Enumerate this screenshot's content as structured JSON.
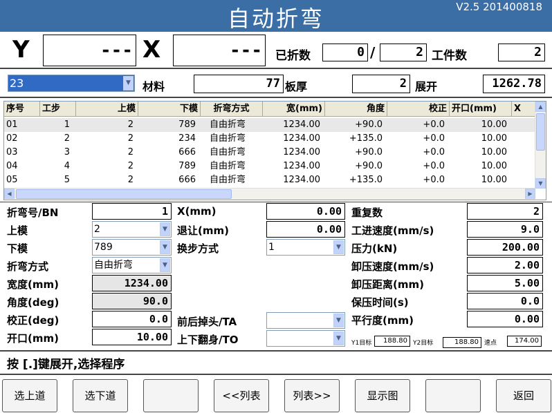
{
  "title": "自动折弯",
  "version": "V2.5 201400818",
  "axis": {
    "y_label": "Y",
    "y_value": "---",
    "x_label": "X",
    "x_value": "---"
  },
  "count": {
    "bent_label": "已折数",
    "bent": "0",
    "separator": "/",
    "total": "2",
    "workpiece_label": "工件数",
    "workpiece": "2"
  },
  "program": {
    "number": "23",
    "material_label": "材料",
    "material": "77",
    "thickness_label": "板厚",
    "thickness": "2",
    "unfold_label": "展开",
    "unfold": "1262.78"
  },
  "table": {
    "headers": [
      "序号",
      "工步",
      "上模",
      "下模",
      "折弯方式",
      "宽(mm)",
      "角度",
      "校正",
      "开口(mm)",
      "X"
    ],
    "rows": [
      [
        "01",
        "1",
        "2",
        "789",
        "自由折弯",
        "1234.00",
        "+90.0",
        "+0.0",
        "10.00"
      ],
      [
        "02",
        "2",
        "2",
        "234",
        "自由折弯",
        "1234.00",
        "+135.0",
        "+0.0",
        "10.00"
      ],
      [
        "03",
        "3",
        "2",
        "666",
        "自由折弯",
        "1234.00",
        "+90.0",
        "+0.0",
        "10.00"
      ],
      [
        "04",
        "4",
        "2",
        "789",
        "自由折弯",
        "1234.00",
        "+90.0",
        "+0.0",
        "10.00"
      ],
      [
        "05",
        "5",
        "2",
        "666",
        "自由折弯",
        "1234.00",
        "+135.0",
        "+0.0",
        "10.00"
      ]
    ]
  },
  "params": {
    "bend_no_label": "折弯号/BN",
    "bend_no": "1",
    "upper_die_label": "上模",
    "upper_die": "2",
    "lower_die_label": "下模",
    "lower_die": "789",
    "bend_mode_label": "折弯方式",
    "bend_mode": "自由折弯",
    "width_label": "宽度(mm)",
    "width": "1234.00",
    "angle_label": "角度(deg)",
    "angle": "90.0",
    "correction_label": "校正(deg)",
    "correction": "0.0",
    "opening_label": "开口(mm)",
    "opening": "10.00",
    "x_label": "X(mm)",
    "x": "0.00",
    "retract_label": "退让(mm)",
    "retract": "0.00",
    "step_mode_label": "换步方式",
    "step_mode": "1",
    "ta_label": "前后掉头/TA",
    "ta": "",
    "to_label": "上下翻身/TO",
    "to": "",
    "repeat_label": "重复数",
    "repeat": "2",
    "work_speed_label": "工进速度(mm/s)",
    "work_speed": "9.0",
    "pressure_label": "压力(kN)",
    "pressure": "200.00",
    "unload_speed_label": "卸压速度(mm/s)",
    "unload_speed": "2.00",
    "unload_dist_label": "卸压距离(mm)",
    "unload_dist": "5.00",
    "hold_time_label": "保压时间(s)",
    "hold_time": "0.0",
    "parallel_label": "平行度(mm)",
    "parallel": "0.00",
    "y1_label": "Y1目标",
    "y1": "188.80",
    "y2_label": "Y2目标",
    "y2": "188.80",
    "speed_label": "速点",
    "speed": "174.00"
  },
  "status": "按 [.]键展开,选择程序",
  "buttons": {
    "prev": "选上道",
    "next": "选下道",
    "blank1": "",
    "list_left": "<<列表",
    "list_right": "列表>>",
    "show_graph": "显示图",
    "blank2": "",
    "back": "返回"
  },
  "colors": {
    "titlebar": "#3a6ea5",
    "selection": "#316ac5"
  }
}
